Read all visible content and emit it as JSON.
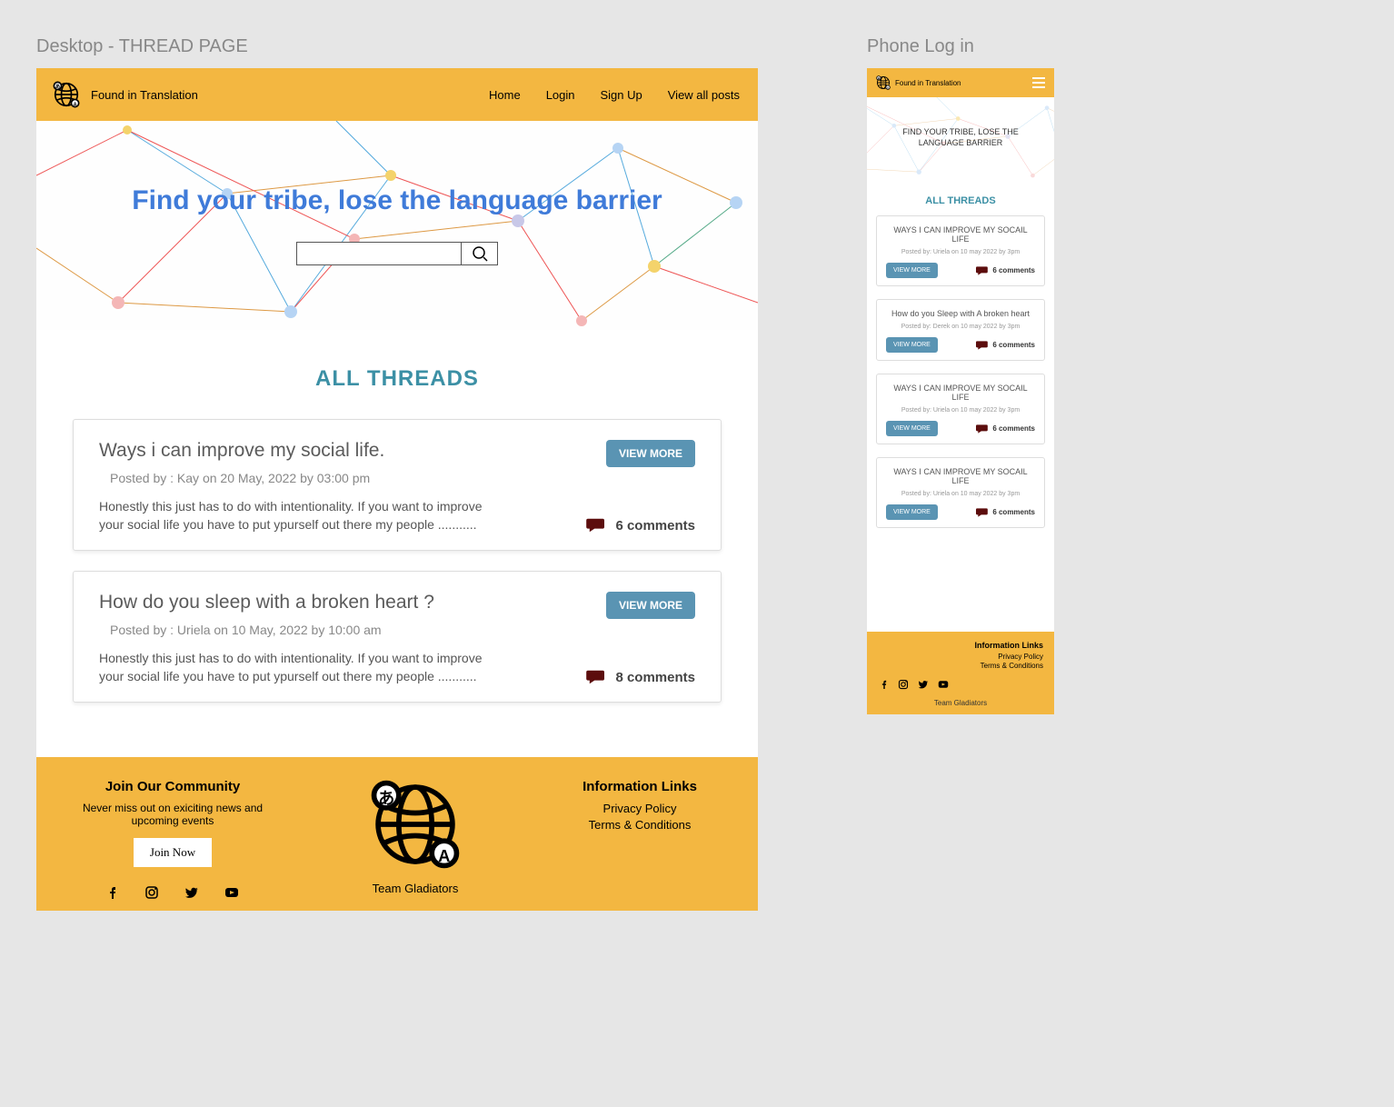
{
  "artboards": {
    "desktop_label": "Desktop -  THREAD PAGE",
    "phone_label": "Phone Log in"
  },
  "brand": {
    "name": "Found in Translation",
    "team": "Team Gladiators"
  },
  "nav": {
    "home": "Home",
    "login": "Login",
    "signup": "Sign Up",
    "viewall": "View all posts"
  },
  "hero": {
    "desktop_title": "Find your tribe, lose the language barrier",
    "phone_title": "FIND YOUR TRIBE, LOSE THE LANGUAGE BARRIER",
    "search_placeholder": ""
  },
  "section": {
    "all_threads": "ALL THREADS"
  },
  "buttons": {
    "view_more": "VIEW MORE",
    "join_now": "Join Now"
  },
  "threads": [
    {
      "title": "Ways i can improve my social life.",
      "meta": "Posted by :  Kay  on  20 May, 2022    by 03:00 pm",
      "body": "Honestly this just has to do with intentionality. If you want to improve your social life you have to put ypurself out there my people ...........",
      "comments": "6 comments"
    },
    {
      "title": "How do you sleep with a broken heart ?",
      "meta": "Posted by :  Uriela  on  10 May, 2022 by 10:00 am",
      "body": "Honestly this just has to do with intentionality. If you want to improve your social life you have to put ypurself out there my people ...........",
      "comments": "8 comments"
    }
  ],
  "phone_threads": [
    {
      "title": "WAYS I CAN IMPROVE MY SOCAIL LIFE",
      "meta": "Posted by: Uriela on 10 may 2022 by 3pm",
      "comments": "6 comments"
    },
    {
      "title": "How do you Sleep with  A broken heart",
      "meta": "Posted by: Derek  on 10 may 2022 by 3pm",
      "comments": "6 comments"
    },
    {
      "title": "WAYS I CAN IMPROVE MY SOCAIL LIFE",
      "meta": "Posted by: Uriela on 10 may 2022 by 3pm",
      "comments": "6 comments"
    },
    {
      "title": "WAYS I CAN IMPROVE MY SOCAIL LIFE",
      "meta": "Posted by: Uriela on 10 may 2022 by 3pm",
      "comments": "6 comments"
    }
  ],
  "footer": {
    "join_heading": "Join Our Community",
    "join_sub": "Never miss out on exiciting news and upcoming events",
    "info_heading": "Information Links",
    "privacy": "Privacy Policy",
    "terms": "Terms & Conditions"
  }
}
